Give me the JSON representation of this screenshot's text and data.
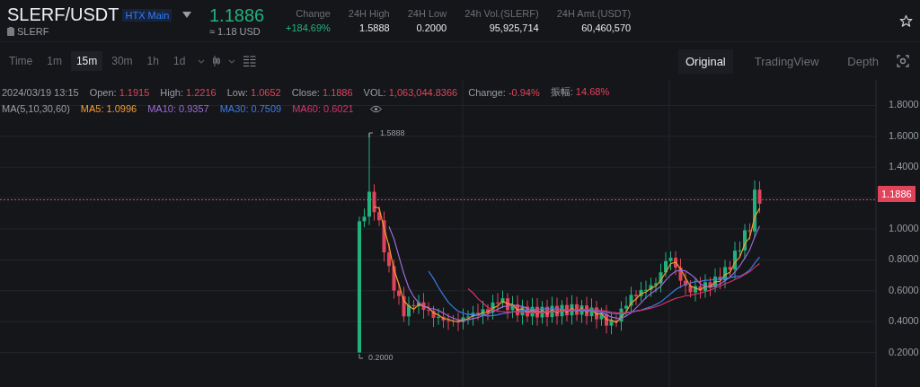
{
  "header": {
    "pair": "SLERF/USDT",
    "badge": "HTX Main",
    "asset": "SLERF",
    "price": "1.1886",
    "price_usd": "≈ 1.18 USD",
    "stats": [
      {
        "label": "Change",
        "value": "+184.69%",
        "kind": "up"
      },
      {
        "label": "24H High",
        "value": "1.5888",
        "kind": "plain"
      },
      {
        "label": "24H Low",
        "value": "0.2000",
        "kind": "plain"
      },
      {
        "label": "24h Vol.(SLERF)",
        "value": "95,925,714",
        "kind": "plain"
      },
      {
        "label": "24H Amt.(USDT)",
        "value": "60,460,570",
        "kind": "plain"
      }
    ]
  },
  "intervals": [
    {
      "label": "Time",
      "selected": false
    },
    {
      "label": "1m",
      "selected": false
    },
    {
      "label": "15m",
      "selected": true
    },
    {
      "label": "30m",
      "selected": false
    },
    {
      "label": "1h",
      "selected": false
    },
    {
      "label": "1d",
      "selected": false
    }
  ],
  "views": [
    {
      "label": "Original",
      "selected": true
    },
    {
      "label": "TradingView",
      "selected": false
    },
    {
      "label": "Depth",
      "selected": false
    }
  ],
  "ohlc": {
    "time": "2024/03/19 13:15",
    "items": [
      {
        "label": "Open:",
        "value": "1.1915"
      },
      {
        "label": "High:",
        "value": "1.2216"
      },
      {
        "label": "Low:",
        "value": "1.0652"
      },
      {
        "label": "Close:",
        "value": "1.1886"
      },
      {
        "label": "VOL:",
        "value": "1,063,044.8366"
      },
      {
        "label": "Change:",
        "value": "-0.94%"
      },
      {
        "label": "振幅:",
        "value": "14.68%"
      }
    ]
  },
  "ma": {
    "label": "MA(5,10,30,60)",
    "items": [
      {
        "label": "MA5: 1.0996",
        "color": "#f39c2f"
      },
      {
        "label": "MA10: 0.9357",
        "color": "#9b6ad6"
      },
      {
        "label": "MA30: 0.7509",
        "color": "#3b7be6"
      },
      {
        "label": "MA60: 0.6021",
        "color": "#d8336a"
      }
    ]
  },
  "y_axis": [
    "1.8000",
    "1.6000",
    "1.4000",
    "1.0000",
    "0.8000",
    "0.6000",
    "0.4000",
    "0.2000"
  ],
  "price_tag": "1.1886",
  "annotations": {
    "high": "1.5888",
    "low": "0.2000"
  }
}
